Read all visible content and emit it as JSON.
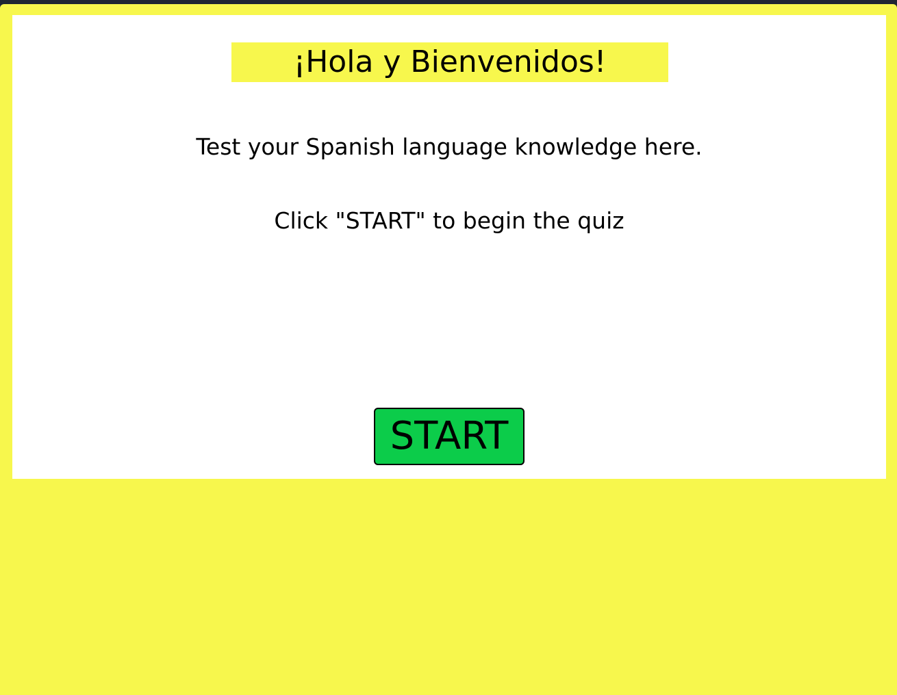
{
  "welcome": {
    "title": "¡Hola y Bienvenidos!",
    "line1": "Test your Spanish language knowledge here.",
    "line2": "Click \"START\" to begin the quiz",
    "start_label": "START"
  },
  "colors": {
    "background": "#f7f74d",
    "card": "#ffffff",
    "title_highlight": "#f7f74d",
    "start_button": "#0ccc4a",
    "text": "#000000"
  }
}
